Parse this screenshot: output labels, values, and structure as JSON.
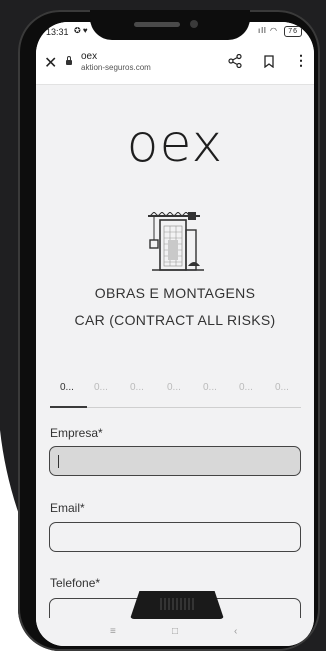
{
  "status_bar": {
    "time": "13:31",
    "notification_icons": "✪ ♥",
    "signal": "ıll",
    "battery": "76"
  },
  "browser": {
    "page_title": "oex",
    "host": "aktion-seguros.com",
    "close_icon": "close-icon",
    "share_icon": "share-icon",
    "bookmark_icon": "bookmark-icon",
    "menu_icon": "more-vert-icon"
  },
  "hero": {
    "logo": "oex",
    "illustration": "building-crane-icon",
    "heading_line1": "OBRAS E MONTAGENS",
    "heading_line2": "CAR (CONTRACT ALL RISKS)"
  },
  "steps": [
    "0...",
    "0...",
    "0...",
    "0...",
    "0...",
    "0...",
    "0..."
  ],
  "active_step": 0,
  "form": {
    "company_label": "Empresa*",
    "company_value": "",
    "email_label": "Email*",
    "email_value": "",
    "phone_label": "Telefone*",
    "phone_value": ""
  },
  "nav": {
    "recents": "≡",
    "home": "□",
    "back": "‹"
  },
  "colors": {
    "screen_bg": "#f2f2f3",
    "text": "#333333",
    "field_active_bg": "#d8d8d8",
    "field_border": "#444444"
  }
}
